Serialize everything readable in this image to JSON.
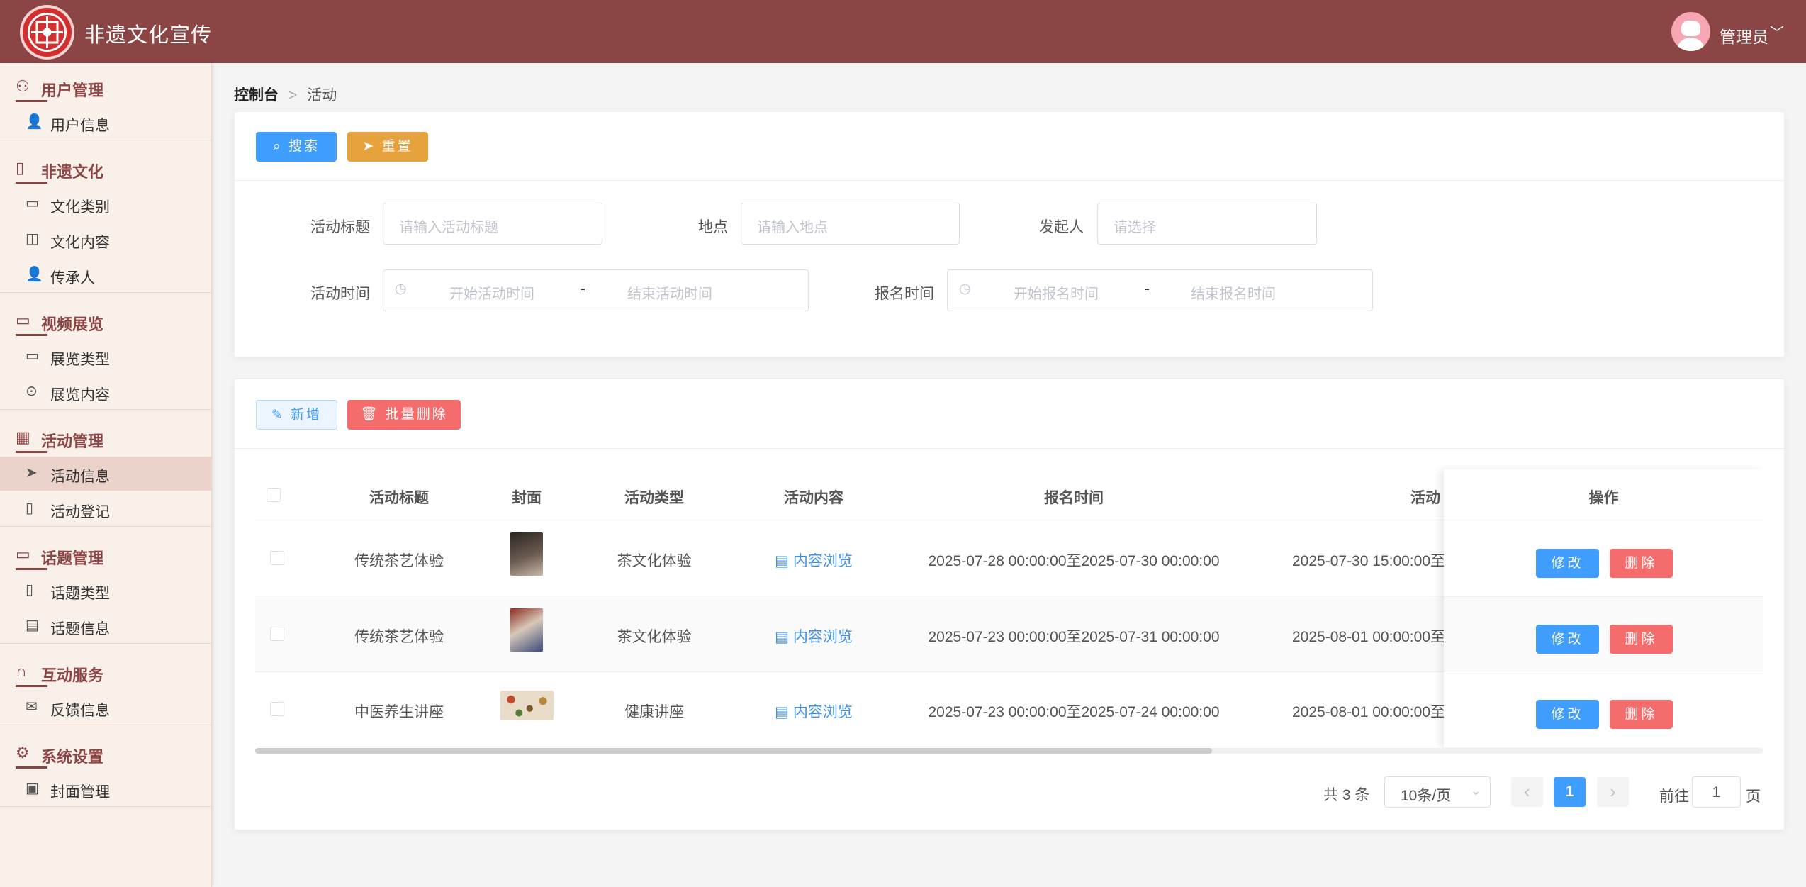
{
  "header": {
    "title": "非遗文化宣传",
    "user": "管理员",
    "caret": "﹀"
  },
  "sidebar": {
    "groups": [
      {
        "label": "用户管理",
        "icon": "user-outline-icon",
        "items": [
          {
            "label": "用户信息",
            "icon": "user-icon"
          }
        ]
      },
      {
        "label": "非遗文化",
        "icon": "book-icon",
        "items": [
          {
            "label": "文化类别",
            "icon": "folder-icon"
          },
          {
            "label": "文化内容",
            "icon": "open-book-icon"
          },
          {
            "label": "传承人",
            "icon": "user-icon"
          }
        ]
      },
      {
        "label": "视频展览",
        "icon": "video-icon",
        "items": [
          {
            "label": "展览类型",
            "icon": "folder-open-icon"
          },
          {
            "label": "展览内容",
            "icon": "play-circle-icon"
          }
        ]
      },
      {
        "label": "活动管理",
        "icon": "calendar-icon",
        "items": [
          {
            "label": "活动信息",
            "icon": "send-icon",
            "active": true
          },
          {
            "label": "活动登记",
            "icon": "document-icon"
          }
        ]
      },
      {
        "label": "话题管理",
        "icon": "chat-icon",
        "items": [
          {
            "label": "话题类型",
            "icon": "bookmark-icon"
          },
          {
            "label": "话题信息",
            "icon": "message-icon"
          }
        ]
      },
      {
        "label": "互动服务",
        "icon": "headset-icon",
        "items": [
          {
            "label": "反馈信息",
            "icon": "mail-icon"
          }
        ]
      },
      {
        "label": "系统设置",
        "icon": "gear-icon",
        "items": [
          {
            "label": "封面管理",
            "icon": "image-icon"
          }
        ]
      }
    ]
  },
  "breadcrumb": {
    "root": "控制台",
    "current": "活动",
    "sep": ">"
  },
  "search": {
    "search_btn": "搜索",
    "reset_btn": "重置",
    "title_label": "活动标题",
    "title_ph": "请输入活动标题",
    "place_label": "地点",
    "place_ph": "请输入地点",
    "initiator_label": "发起人",
    "initiator_ph": "请选择",
    "act_time_label": "活动时间",
    "act_start_ph": "开始活动时间",
    "act_end_ph": "结束活动时间",
    "reg_time_label": "报名时间",
    "reg_start_ph": "开始报名时间",
    "reg_end_ph": "结束报名时间",
    "range_sep": "-"
  },
  "toolbar": {
    "add_btn": "新增",
    "batch_delete_btn": "批量删除"
  },
  "table": {
    "headers": {
      "title": "活动标题",
      "cover": "封面",
      "type": "活动类型",
      "content": "活动内容",
      "reg_time": "报名时间",
      "act_time": "活动",
      "ops": "操作"
    },
    "rows": [
      {
        "title": "传统茶艺体验",
        "type": "茶文化体验",
        "content": "内容浏览",
        "reg_time": "2025-07-28 00:00:00至2025-07-30 00:00:00",
        "act_time": "2025-07-30 15:00:00至"
      },
      {
        "title": "传统茶艺体验",
        "type": "茶文化体验",
        "content": "内容浏览",
        "reg_time": "2025-07-23 00:00:00至2025-07-31 00:00:00",
        "act_time": "2025-08-01 00:00:00至"
      },
      {
        "title": "中医养生讲座",
        "type": "健康讲座",
        "content": "内容浏览",
        "reg_time": "2025-07-23 00:00:00至2025-07-24 00:00:00",
        "act_time": "2025-08-01 00:00:00至"
      }
    ],
    "edit_btn": "修改",
    "delete_btn": "删除"
  },
  "pagination": {
    "total": "共 3 条",
    "page_size": "10条/页",
    "current": "1",
    "goto_label": "前往",
    "goto_value": "1",
    "page_unit": "页",
    "prev": "‹",
    "next": "›"
  },
  "colors": {
    "brand": "#8c4545",
    "primary": "#409eff",
    "warning": "#e6a23c",
    "danger": "#f56c6c"
  }
}
